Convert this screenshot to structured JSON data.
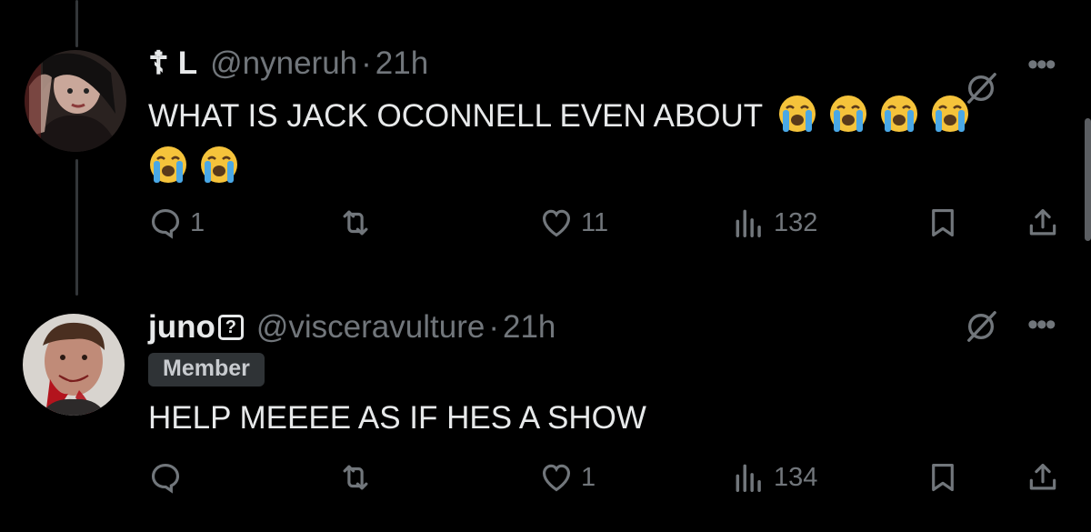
{
  "tweets": [
    {
      "name_prefix": "☦",
      "name": "L",
      "handle": "@nyneruh",
      "time": "21h",
      "text": "WHAT IS JACK OCONNELL EVEN ABOUT",
      "emoji_count": 6,
      "emoji_name": "loudly-crying-face",
      "replies": "1",
      "reposts": "",
      "likes": "11",
      "views": "132"
    },
    {
      "name": "juno",
      "name_badge": "?",
      "handle": "@visceravulture",
      "time": "21h",
      "community_badge": "Member",
      "text": "HELP MEEEE AS IF HES A SHOW",
      "replies": "",
      "reposts": "",
      "likes": "1",
      "views": "134"
    }
  ],
  "icons": [
    "reply-icon",
    "repost-icon",
    "like-icon",
    "views-icon",
    "bookmark-icon",
    "share-icon",
    "grok-icon",
    "more-icon"
  ],
  "colors": {
    "background": "#000000",
    "text": "#e7e9ea",
    "muted": "#71767b",
    "badge_bg": "#2f3336"
  }
}
